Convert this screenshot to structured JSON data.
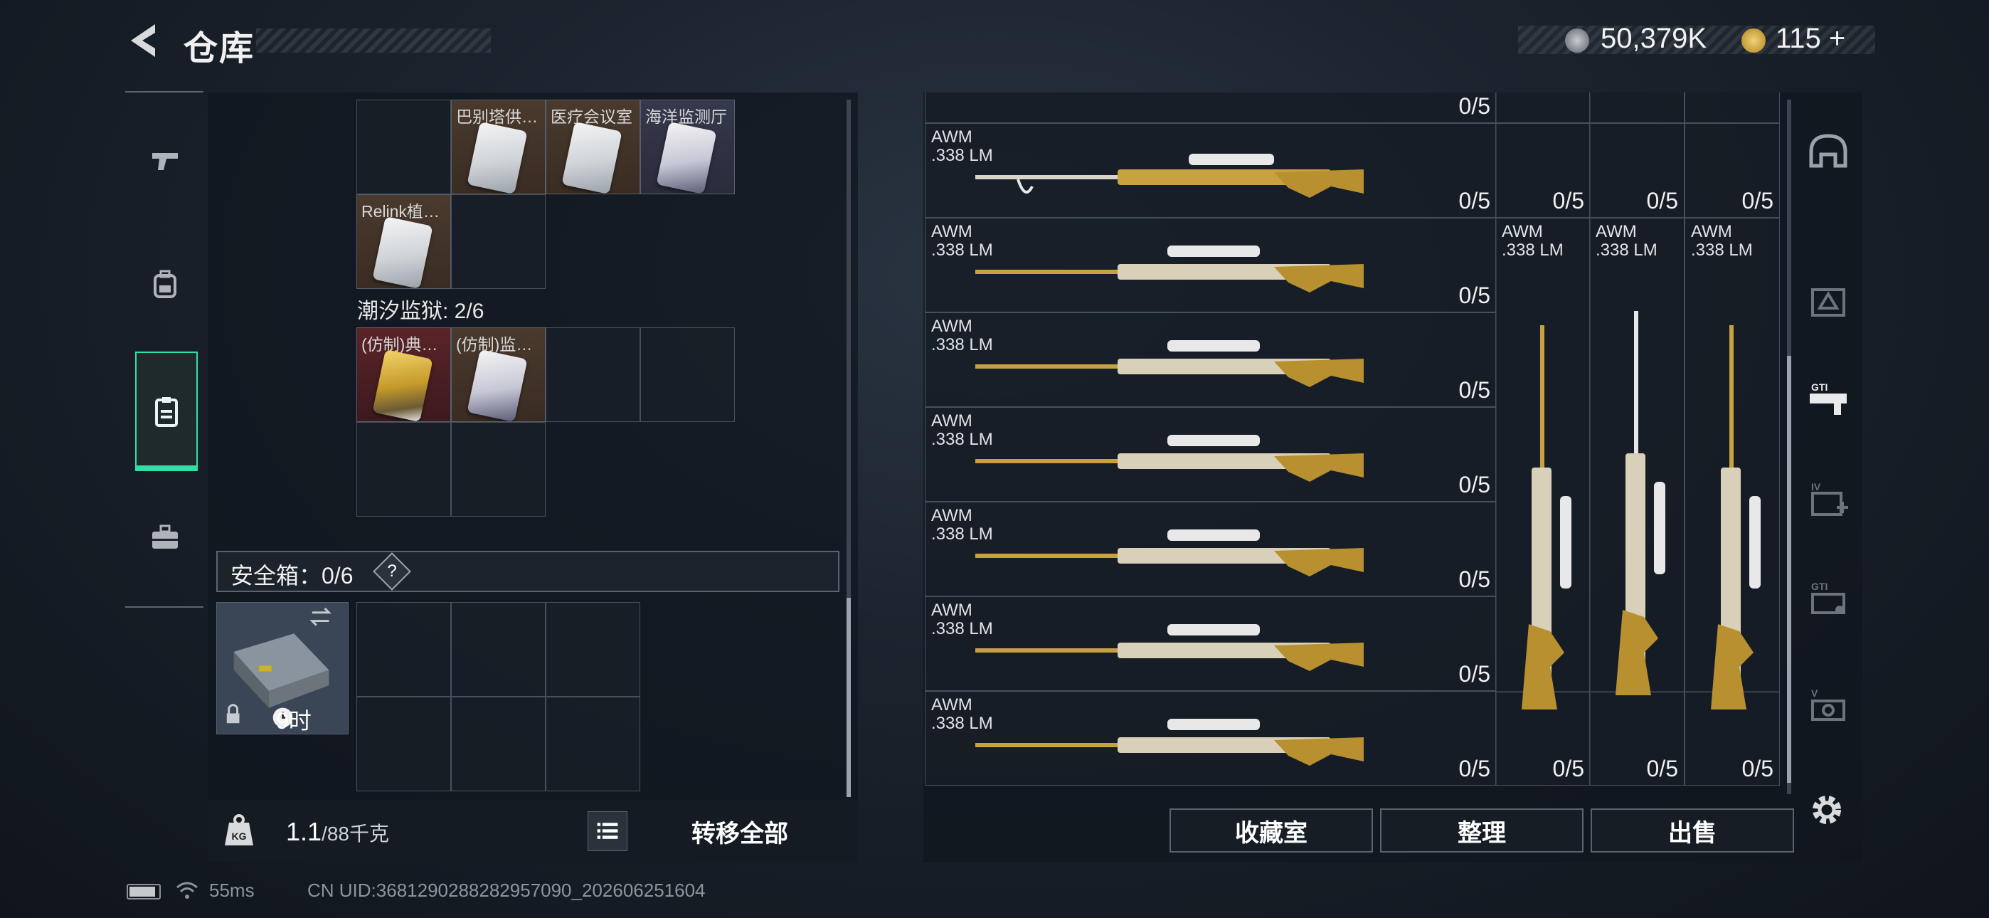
{
  "header": {
    "title": "仓库",
    "currency1": "50,379K",
    "currency2": "115",
    "add": "+"
  },
  "left_nav": {
    "items": [
      {
        "name": "weapons",
        "icon": "pistol-icon"
      },
      {
        "name": "backpack",
        "icon": "backpack-icon"
      },
      {
        "name": "cards",
        "icon": "clipboard-icon",
        "active": true
      },
      {
        "name": "toolbox",
        "icon": "toolbox-icon"
      }
    ]
  },
  "stash": {
    "items_row1": [
      "巴别塔供…",
      "医疗会议室",
      "海洋监测厅"
    ],
    "items_row2": [
      "Relink植…"
    ],
    "section_label": "潮汐监狱: 2/6",
    "items_row3": [
      "(仿制)典…",
      "(仿制)监…"
    ],
    "safe_label": "安全箱：0/6",
    "safe_help": "?",
    "safe_timer": "9时"
  },
  "footer_left": {
    "weight_value": "1.1",
    "weight_max": "/88千克",
    "transfer_label": "转移全部"
  },
  "weapons": {
    "name": "AWM",
    "caliber": ".338 LM",
    "counts": [
      "0/5",
      "0/5",
      "0/5",
      "0/5",
      "0/5",
      "0/5",
      "0/5",
      "0/5",
      "0/5",
      "0/5",
      "0/5",
      "0/5",
      "0/5",
      "0/5"
    ]
  },
  "right_buttons": {
    "collection": "收藏室",
    "sort": "整理",
    "sell": "出售"
  },
  "status": {
    "ping": "55ms",
    "uid": "CN UID:3681290288282957090_202606251604"
  }
}
